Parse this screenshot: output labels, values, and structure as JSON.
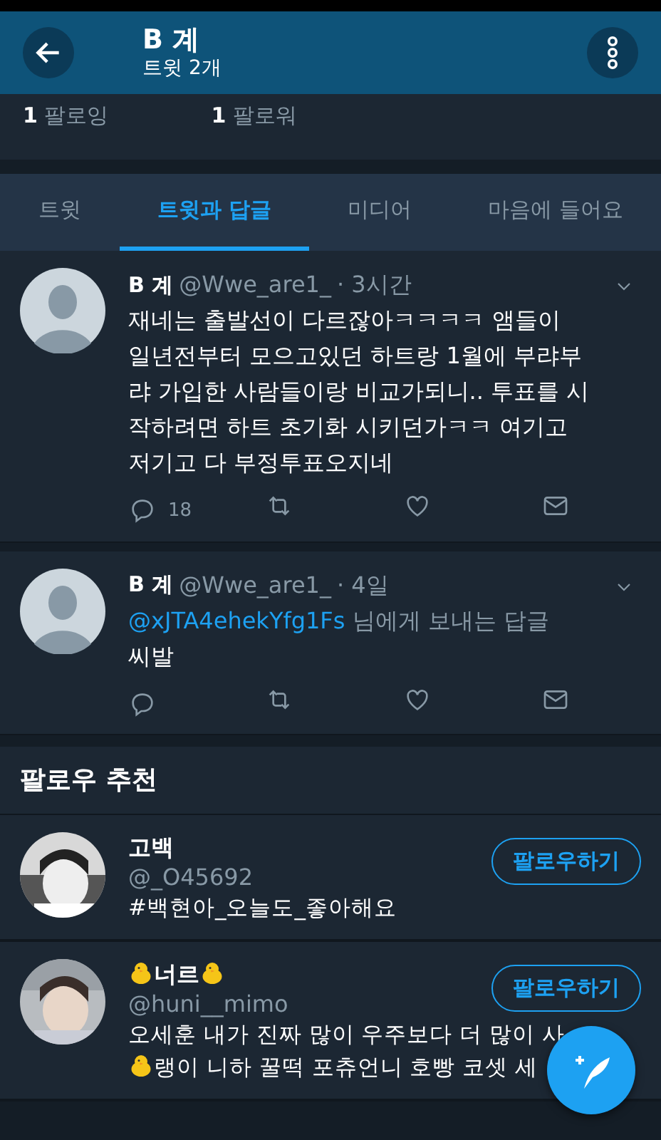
{
  "header": {
    "title": "B 계",
    "subtitle": "트윗 2개"
  },
  "stats": [
    {
      "count": "1",
      "label": "팔로잉"
    },
    {
      "count": "1",
      "label": "팔로워"
    }
  ],
  "tabs": [
    {
      "label": "트윗",
      "selected": false
    },
    {
      "label": "트윗과 답글",
      "selected": true
    },
    {
      "label": "미디어",
      "selected": false
    },
    {
      "label": "마음에 들어요",
      "selected": false
    }
  ],
  "tweets": [
    {
      "name": "B 계",
      "handle": "@Wwe_are1_",
      "time": "· 3시간",
      "text": "재네는 출발선이 다르잖아ㅋㅋㅋㅋ 앰들이 일년전부터 모으고있던 하트랑 1월에 부랴부랴 가입한 사람들이랑 비교가되니.. 투표를 시작하려면 하트 초기화 시키던가ㅋㅋ 여기고 저기고 다 부정투표오지네",
      "reply_count": "18"
    },
    {
      "name": "B 계",
      "handle": "@Wwe_are1_",
      "time": "· 4일",
      "reply_to": "@xJTA4ehekYfg1Fs",
      "reply_note": "님에게 보내는 답글",
      "text": "씨발"
    }
  ],
  "suggestions": {
    "title": "팔로우 추천",
    "items": [
      {
        "name": "고백",
        "chick_name": false,
        "handle": "@_O45692",
        "bio": [
          {
            "text": "#백현아_오늘도_좋아해요",
            "chick": false
          }
        ],
        "button": "팔로우하기"
      },
      {
        "name": "너르",
        "chick_name": true,
        "handle": "@huni__mimo",
        "bio": [
          {
            "text": "오세훈 내가 진짜 많이 우주보다 더 많이 사",
            "chick": false
          },
          {
            "text": "랭이 니하 꿀떡 포츄언니 호빵 코셋 세",
            "chick": true
          }
        ],
        "button": "팔로우하기"
      }
    ]
  }
}
